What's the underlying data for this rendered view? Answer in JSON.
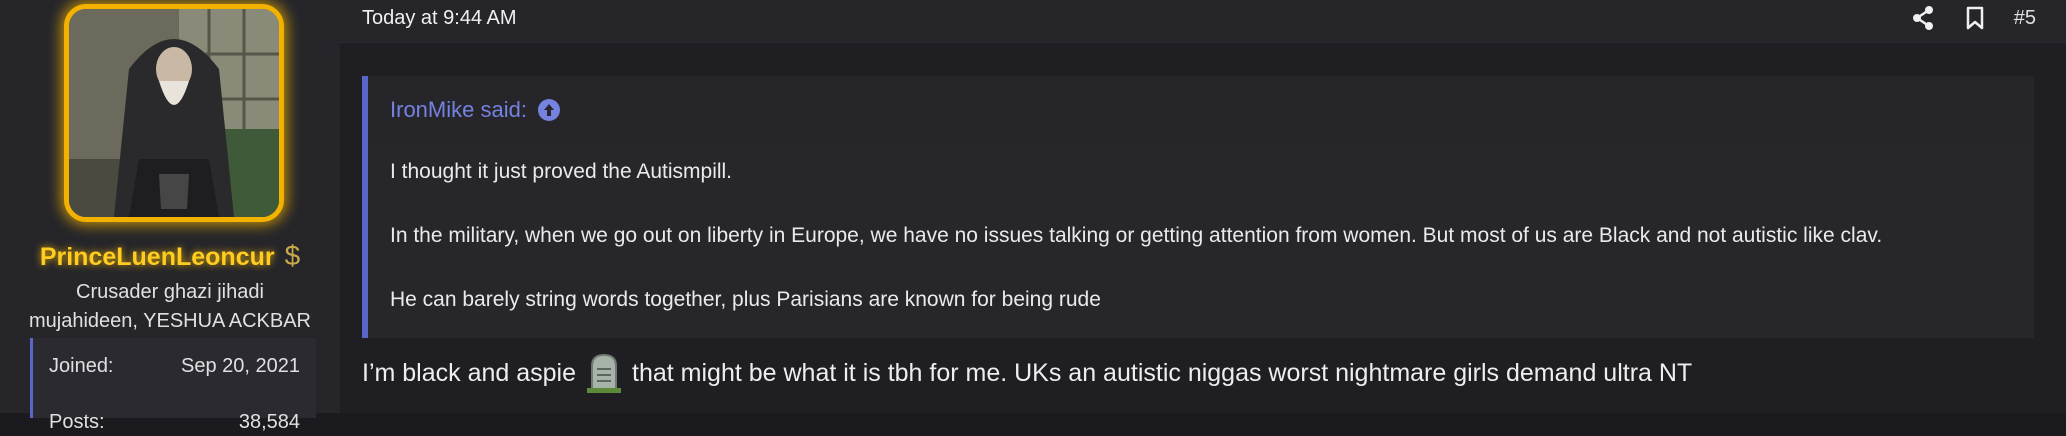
{
  "user": {
    "username": "PrinceLuenLeoncur",
    "title": "Crusader ghazi jihadi mujahideen, YESHUA ACKBAR",
    "badge_icon": "dollar-icon",
    "stats": [
      {
        "label": "Joined:",
        "value": "Sep 20, 2021"
      },
      {
        "label": "Posts:",
        "value": "38,584"
      }
    ]
  },
  "post": {
    "date": "Today at 9:44 AM",
    "number": "#5",
    "actions": [
      "share-icon",
      "bookmark-icon"
    ],
    "quote": {
      "author_line": "IronMike said:",
      "paragraphs": [
        "I thought it just proved the Autismpill.",
        "In the military, when we go out on liberty in Europe, we have no issues talking or getting attention from women. But most of us are Black and not autistic like clav.",
        "He can barely string words together, plus Parisians are known for being rude"
      ]
    },
    "message_before": "I’m black and aspie",
    "message_after": "that might be what it is tbh for me. UKs an autistic niggas worst nightmare girls demand ultra NT",
    "emoji": "grave-icon"
  },
  "colors": {
    "accent": "#5a65c8",
    "username": "#ffcc21",
    "avatar_border": "#f3b100",
    "background": "#1b1b1f"
  }
}
